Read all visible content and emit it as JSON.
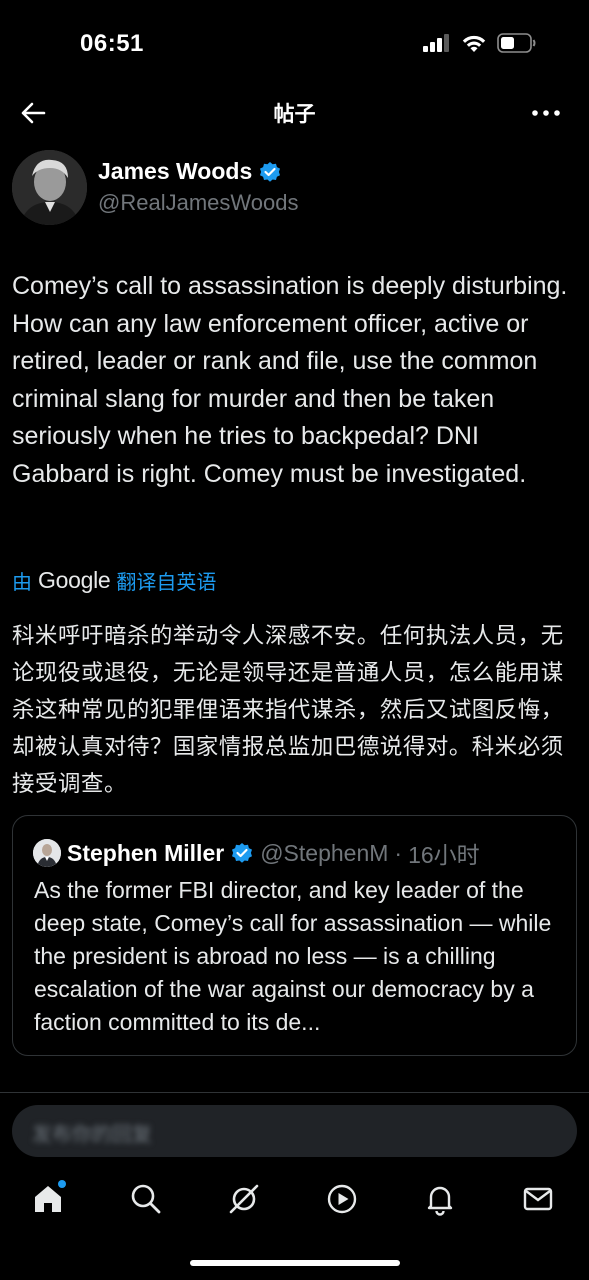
{
  "status_bar": {
    "time": "06:51"
  },
  "header": {
    "title": "帖子"
  },
  "tweet": {
    "author_name": "James Woods",
    "author_handle": "@RealJamesWoods",
    "text": "Comey’s call to assassination is deeply disturbing. How can any law enforcement officer, active or retired, leader or rank and file, use the common criminal slang for murder and then be taken seriously when he tries to backpedal? DNI Gabbard is right. Comey must be investigated.",
    "translation": {
      "prefix": "由",
      "provider": "Google",
      "label": "翻译自英语",
      "text": "科米呼吁暗杀的举动令人深感不安。任何执法人员，无论现役或退役，无论是领导还是普通人员，怎么能用谋杀这种常见的犯罪俚语来指代谋杀，然后又试图反悔，却被认真对待？国家情报总监加巴德说得对。科米必须接受调查。"
    }
  },
  "quote": {
    "author_name": "Stephen Miller",
    "author_handle": "@StephenM",
    "separator": "·",
    "time": "16小时",
    "text": "As the former FBI director, and key leader of the deep state, Comey’s call for assassination — while the president is abroad no less — is a chilling escalation of the war against our democracy by a faction committed to its de..."
  },
  "reply": {
    "placeholder": "发布你的回复"
  },
  "tab_bar": {
    "items": [
      {
        "icon": "home-icon",
        "active": true
      },
      {
        "icon": "search-icon"
      },
      {
        "icon": "grok-icon"
      },
      {
        "icon": "video-play-icon"
      },
      {
        "icon": "bell-icon"
      },
      {
        "icon": "mail-icon"
      }
    ]
  },
  "colors": {
    "accent": "#1d9bf0",
    "background": "#000000",
    "secondary_text": "#71767b",
    "border": "#2f3336"
  }
}
